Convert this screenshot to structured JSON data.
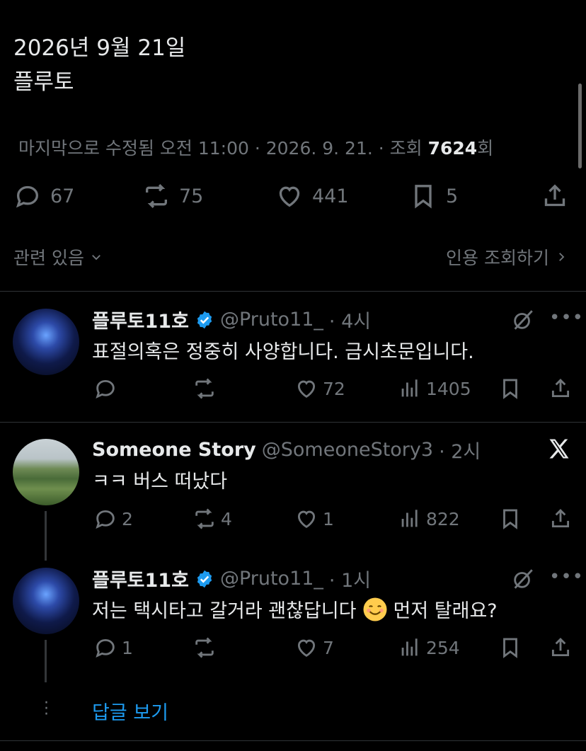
{
  "post": {
    "date": "2026년 9월 21일",
    "body": "플루토",
    "meta_prefix": "마지막으로 수정됨 오전 11:00 · 2026. 9. 21. · 조회 ",
    "views": "7624",
    "meta_suffix": "회",
    "stats": {
      "replies": "67",
      "reposts": "75",
      "likes": "441",
      "bookmarks": "5"
    },
    "related_label": "관련 있음",
    "quote_views_label": "인용 조회하기"
  },
  "replies": [
    {
      "name": "플루토11호",
      "handle": "@Pruto11_",
      "time": "· 4시",
      "text": "표절의혹은 정중히 사양합니다. 금시초문입니다.",
      "likes": "72",
      "views": "1405"
    },
    {
      "name": "Someone Story",
      "handle": "@SomeoneStory3",
      "time": "· 2시",
      "text": "ㅋㅋ 버스 떠났다",
      "replies": "2",
      "reposts": "4",
      "likes": "1",
      "views": "822"
    },
    {
      "name": "플루토11호",
      "handle": "@Pruto11_",
      "time": "· 1시",
      "text_before": "저는 택시타고 갈거라 괜찮답니다",
      "text_after": "먼저 탈래요?",
      "replies": "1",
      "likes": "7",
      "views": "254"
    }
  ],
  "show_replies_label": "답글 보기",
  "colors": {
    "background": "#000000",
    "text": "#e7e9ea",
    "muted": "#71767b",
    "accent": "#1d9bf0",
    "divider": "#2f3336"
  },
  "icons": [
    "reply-icon",
    "repost-icon",
    "like-icon",
    "bookmark-icon",
    "share-icon",
    "views-icon",
    "verified-icon",
    "grok-icon",
    "more-icon",
    "x-logo-icon",
    "chevron-down-icon",
    "chevron-right-icon"
  ]
}
